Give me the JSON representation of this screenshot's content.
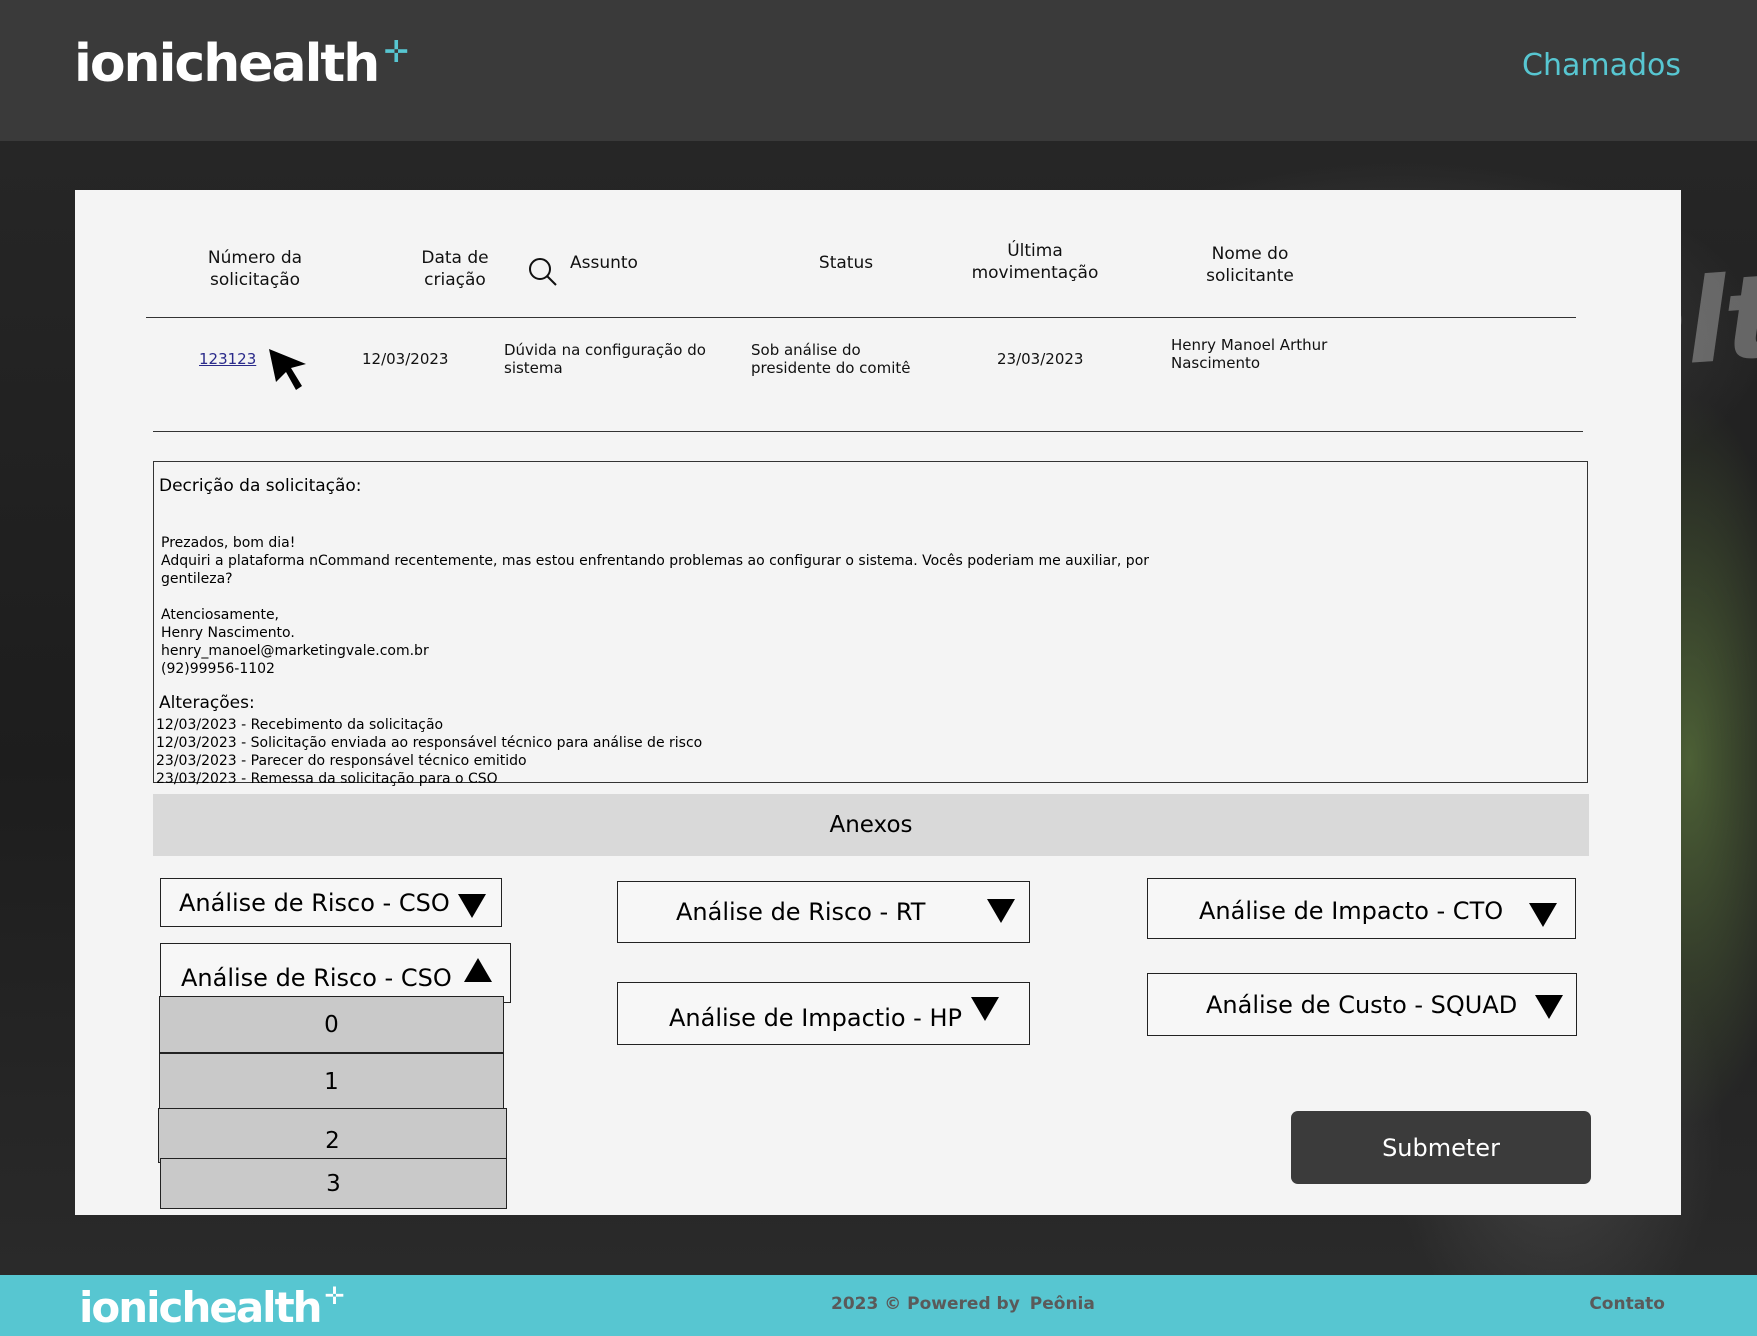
{
  "header": {
    "logo_text": "ionichealth",
    "logo_mark": "✛",
    "nav_link": "Chamados"
  },
  "background_brand": "ionichealth",
  "table": {
    "headers": {
      "number": "Número da\nsolicitação",
      "created": "Data de\ncriação",
      "subject": "Assunto",
      "status": "Status",
      "last_move": "Última\nmovimentação",
      "requester": "Nome do\nsolicitante"
    },
    "row": {
      "number": "123123",
      "created": "12/03/2023",
      "subject": "Dúvida na configuração do\nsistema",
      "status": "Sob análise do\npresidente do comitê",
      "last_move": "23/03/2023",
      "requester": "Henry Manoel Arthur\nNascimento"
    }
  },
  "description": {
    "label": "Decrição da solicitação:",
    "body": "Prezados, bom dia!\nAdquiri a plataforma nCommand recentemente, mas estou enfrentando problemas ao configurar o sistema. Vocês poderiam me auxiliar, por\ngentileza?\n\nAtenciosamente,\nHenry Nascimento.\nhenry_manoel@marketingvale.com.br\n(92)99956-1102",
    "changes_label": "Alterações:",
    "changes": "12/03/2023 - Recebimento da solicitação\n12/03/2023 - Solicitação enviada ao responsável técnico para análise de risco\n23/03/2023 - Parecer do responsável técnico emitido\n23/03/2023 - Remessa da solicitação para o CSO"
  },
  "attachments_label": "Anexos",
  "selects": {
    "risk_cso": "Análise de Risco - CSO",
    "risk_cso_open": "Análise de Risco - CSO",
    "risk_rt": "Análise de Risco - RT",
    "impact_hp": "Análise de Impactio - HP",
    "impact_cto": "Análise de Impacto - CTO",
    "cost_squad": "Análise de Custo - SQUAD"
  },
  "dropdown_options": [
    "0",
    "1",
    "2",
    "3"
  ],
  "submit_label": "Submeter",
  "footer": {
    "copyright": "2023 © Powered by",
    "brand": "Peônia",
    "contact": "Contato"
  },
  "colors": {
    "accent": "#57c6d1",
    "header_bg": "#3a3a3a",
    "button_bg": "#3b3b3b"
  },
  "icons": {
    "search": "search-icon",
    "cursor": "cursor-arrow-icon",
    "dropdown": "triangle-down-icon"
  }
}
